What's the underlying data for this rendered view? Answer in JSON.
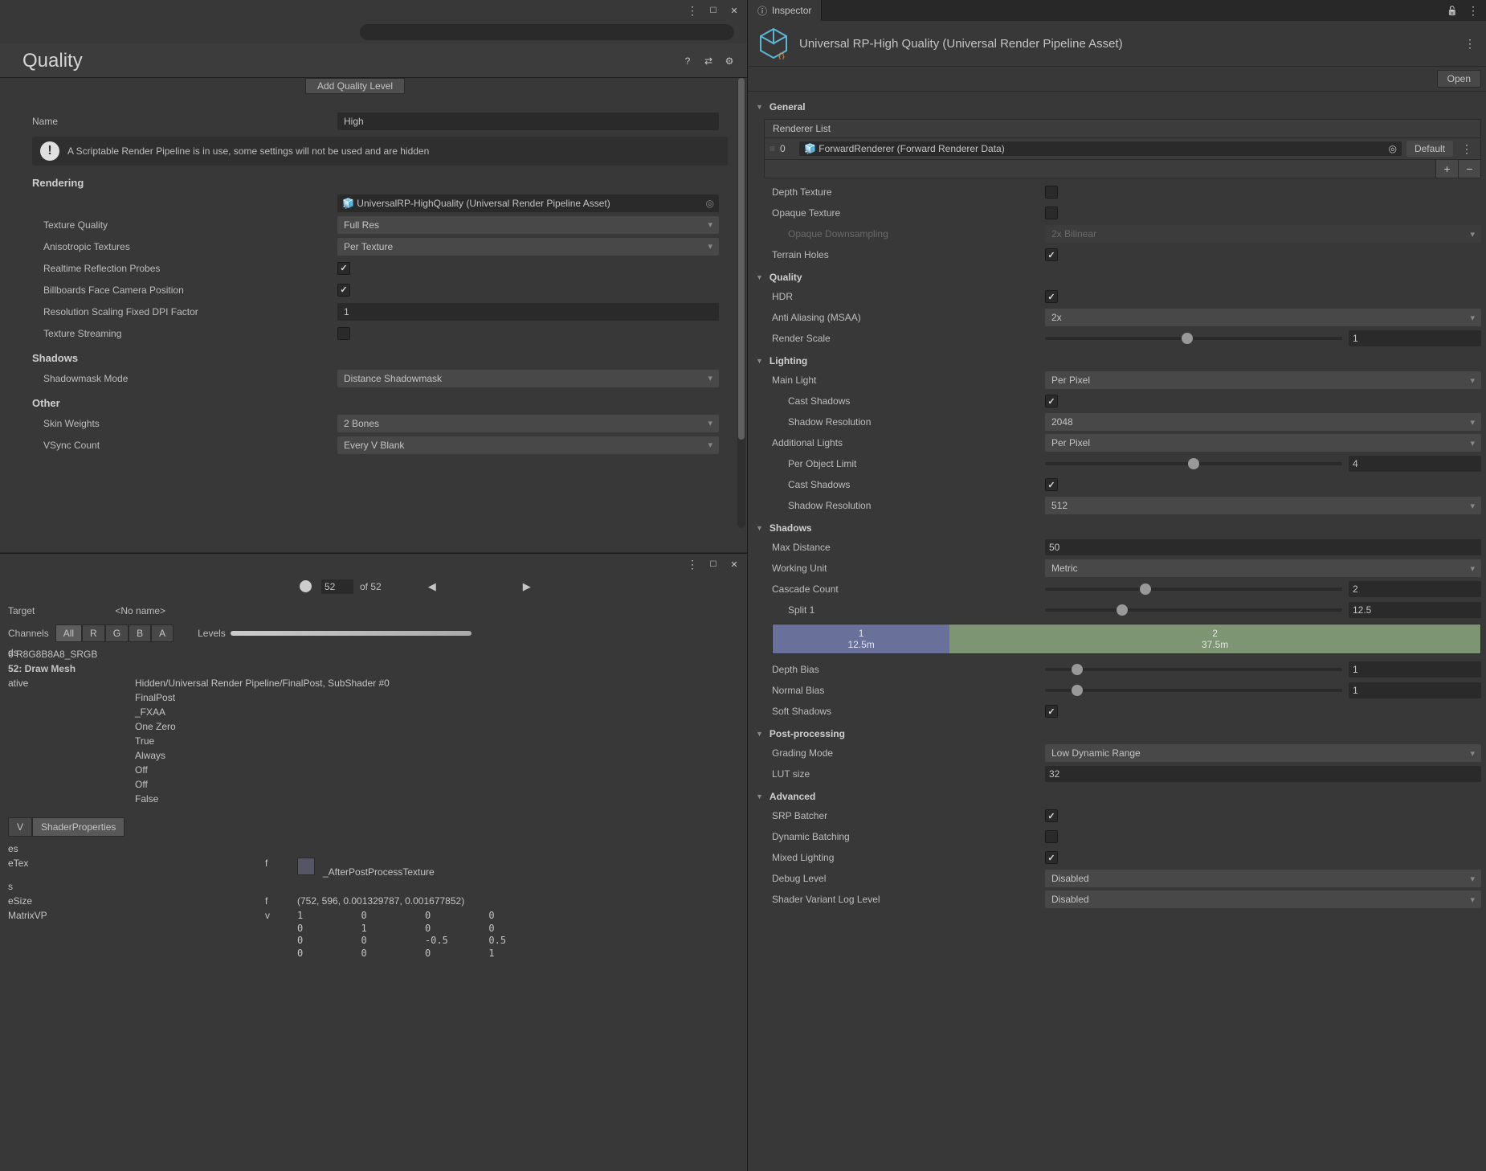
{
  "project_settings": {
    "title": "Quality",
    "add_level_btn": "Add Quality Level",
    "name_label": "Name",
    "name_value": "High",
    "info_msg": "A Scriptable Render Pipeline is in use, some settings will not be used and are hidden",
    "rendering_h": "Rendering",
    "pipeline_asset": "UniversalRP-HighQuality (Universal Render Pipeline Asset)",
    "texture_quality_label": "Texture Quality",
    "texture_quality_value": "Full Res",
    "aniso_label": "Anisotropic Textures",
    "aniso_value": "Per Texture",
    "reflect_label": "Realtime Reflection Probes",
    "billboards_label": "Billboards Face Camera Position",
    "dpi_label": "Resolution Scaling Fixed DPI Factor",
    "dpi_value": "1",
    "tex_stream_label": "Texture Streaming",
    "shadows_h": "Shadows",
    "shadowmask_label": "Shadowmask Mode",
    "shadowmask_value": "Distance Shadowmask",
    "other_h": "Other",
    "skin_label": "Skin Weights",
    "skin_value": "2 Bones",
    "vsync_label": "VSync Count",
    "vsync_value": "Every V Blank"
  },
  "frame_debugger": {
    "frame_value": "52",
    "frame_total": "of 52",
    "target_label": "Target",
    "target_value": "<No name>",
    "channels_label": "Channels",
    "ch_all": "All",
    "ch_r": "R",
    "ch_g": "G",
    "ch_b": "B",
    "ch_a": "A",
    "levels_label": "Levels",
    "fmt_line": "6 R8G8B8A8_SRGB",
    "event_line": "52: Draw Mesh",
    "details": [
      "Hidden/Universal Render Pipeline/FinalPost, SubShader #0",
      "FinalPost",
      "_FXAA",
      "One Zero",
      "True",
      "Always",
      "Off",
      "Off",
      "False"
    ],
    "left_stub1": "ds",
    "left_stub2": "ative",
    "tab_view": "V",
    "tab_shader": "ShaderProperties",
    "props_h": "es",
    "prop1_name": "eTex",
    "prop1_type": "f",
    "prop1_val": "_AfterPostProcessTexture",
    "props_h2": "s",
    "prop2_name": "eSize",
    "prop2_type": "f",
    "prop2_val": "(752, 596, 0.001329787, 0.001677852)",
    "prop3_name": "MatrixVP",
    "prop3_type": "v",
    "matrix": "1          0          0          0\n0          1          0          0\n0          0          -0.5       0.5\n0          0          0          1"
  },
  "inspector": {
    "tab_label": "Inspector",
    "asset_title": "Universal RP-High Quality (Universal Render Pipeline Asset)",
    "open_btn": "Open",
    "general_h": "General",
    "renderer_list_h": "Renderer List",
    "renderer_idx": "0",
    "renderer_obj": "ForwardRenderer (Forward Renderer Data)",
    "renderer_default": "Default",
    "depth_tex_label": "Depth Texture",
    "opaque_tex_label": "Opaque Texture",
    "opaque_ds_label": "Opaque Downsampling",
    "opaque_ds_value": "2x Bilinear",
    "terrain_label": "Terrain Holes",
    "quality_h": "Quality",
    "hdr_label": "HDR",
    "aa_label": "Anti Aliasing (MSAA)",
    "aa_value": "2x",
    "render_scale_label": "Render Scale",
    "render_scale_value": "1",
    "lighting_h": "Lighting",
    "main_light_label": "Main Light",
    "main_light_value": "Per Pixel",
    "cast_shadows_label": "Cast Shadows",
    "shadow_res_label": "Shadow Resolution",
    "main_shadow_res_value": "2048",
    "addl_lights_label": "Additional Lights",
    "addl_lights_value": "Per Pixel",
    "per_obj_limit_label": "Per Object Limit",
    "per_obj_limit_value": "4",
    "addl_cast_label": "Cast Shadows",
    "addl_shadow_res_label": "Shadow Resolution",
    "addl_shadow_res_value": "512",
    "shadows_h": "Shadows",
    "max_dist_label": "Max Distance",
    "max_dist_value": "50",
    "working_unit_label": "Working Unit",
    "working_unit_value": "Metric",
    "cascade_count_label": "Cascade Count",
    "cascade_count_value": "2",
    "split1_label": "Split 1",
    "split1_value": "12.5",
    "cascade1_idx": "1",
    "cascade1_val": "12.5m",
    "cascade2_idx": "2",
    "cascade2_val": "37.5m",
    "depth_bias_label": "Depth Bias",
    "depth_bias_value": "1",
    "normal_bias_label": "Normal Bias",
    "normal_bias_value": "1",
    "soft_shadows_label": "Soft Shadows",
    "post_h": "Post-processing",
    "grading_label": "Grading Mode",
    "grading_value": "Low Dynamic Range",
    "lut_label": "LUT size",
    "lut_value": "32",
    "advanced_h": "Advanced",
    "srp_label": "SRP Batcher",
    "dyn_batch_label": "Dynamic Batching",
    "mixed_light_label": "Mixed Lighting",
    "debug_level_label": "Debug Level",
    "debug_level_value": "Disabled",
    "shader_log_label": "Shader Variant Log Level",
    "shader_log_value": "Disabled"
  }
}
